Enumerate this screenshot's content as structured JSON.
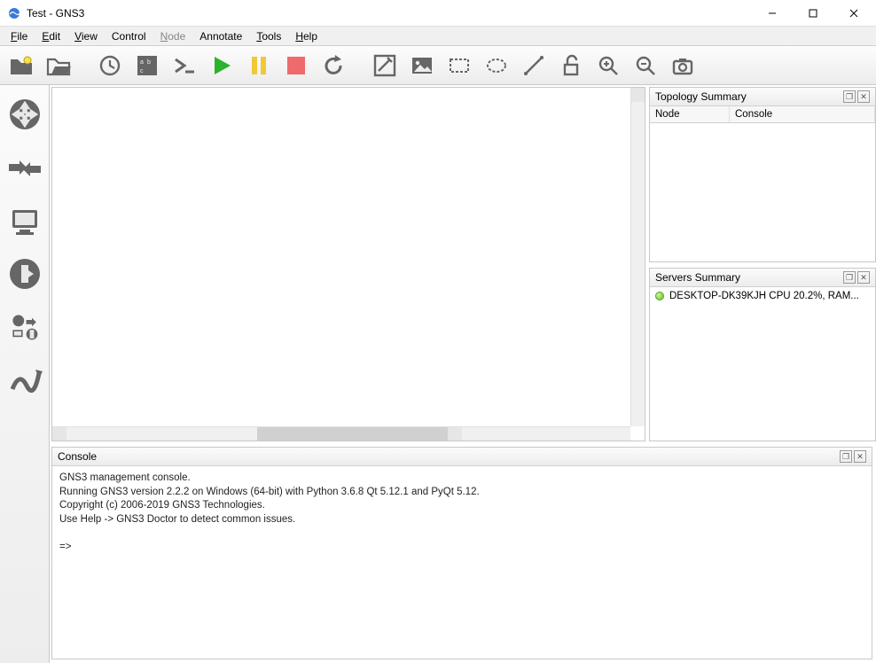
{
  "window": {
    "title": "Test - GNS3"
  },
  "menu": {
    "items": [
      {
        "label": "File",
        "accel": "F",
        "enabled": true
      },
      {
        "label": "Edit",
        "accel": "E",
        "enabled": true
      },
      {
        "label": "View",
        "accel": "V",
        "enabled": true
      },
      {
        "label": "Control",
        "accel": "",
        "enabled": true
      },
      {
        "label": "Node",
        "accel": "N",
        "enabled": false
      },
      {
        "label": "Annotate",
        "accel": "",
        "enabled": true
      },
      {
        "label": "Tools",
        "accel": "T",
        "enabled": true
      },
      {
        "label": "Help",
        "accel": "H",
        "enabled": true
      }
    ]
  },
  "toolbar": {
    "new_project": "new-project-icon",
    "open_project": "open-project-icon",
    "recent": "recent-icon",
    "grid": "show-grid-icon",
    "console": "console-icon",
    "start": "start-icon",
    "suspend": "suspend-icon",
    "stop": "stop-icon",
    "reload": "reload-icon",
    "note": "add-note-icon",
    "picture": "add-picture-icon",
    "rectangle": "draw-rectangle-icon",
    "ellipse": "draw-ellipse-icon",
    "line": "draw-line-icon",
    "lock": "lock-icon",
    "zoom_in": "zoom-in-icon",
    "zoom_out": "zoom-out-icon",
    "screenshot": "screenshot-icon"
  },
  "devicebar": {
    "routers": "routers-icon",
    "switches": "switches-icon",
    "end_devices": "end-devices-icon",
    "security": "security-icon",
    "all_devices": "all-devices-icon",
    "add_link": "add-link-icon"
  },
  "panels": {
    "topology": {
      "title": "Topology Summary",
      "columns": {
        "node": "Node",
        "console": "Console"
      }
    },
    "servers": {
      "title": "Servers Summary",
      "items": [
        {
          "status": "running",
          "text": "DESKTOP-DK39KJH CPU 20.2%, RAM..."
        }
      ]
    },
    "console": {
      "title": "Console",
      "lines": [
        "GNS3 management console.",
        "Running GNS3 version 2.2.2 on Windows (64-bit) with Python 3.6.8 Qt 5.12.1 and PyQt 5.12.",
        "Copyright (c) 2006-2019 GNS3 Technologies.",
        "Use Help -> GNS3 Doctor to detect common issues.",
        "",
        "=>"
      ]
    }
  }
}
